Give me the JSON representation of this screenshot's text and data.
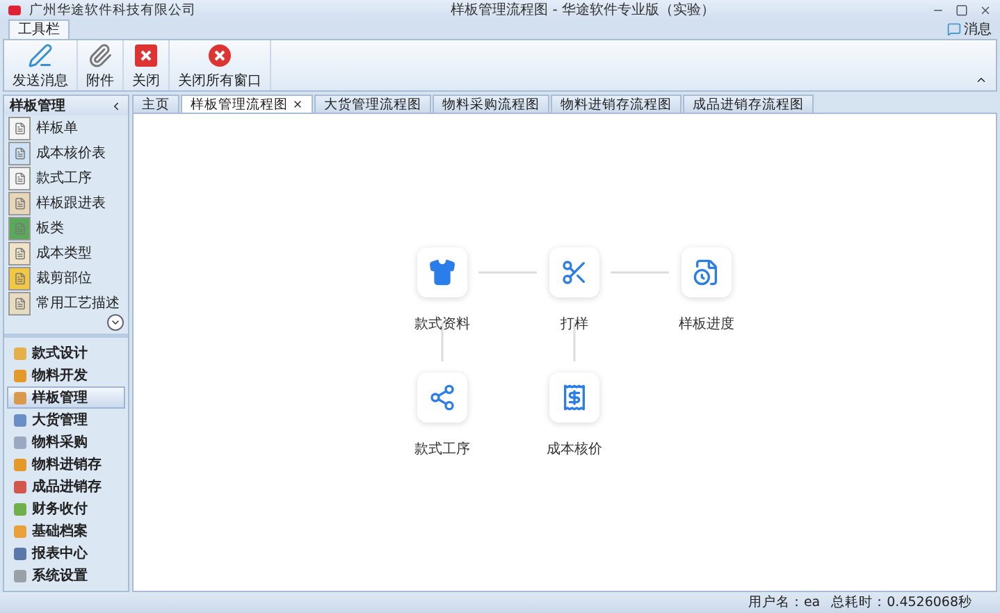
{
  "window": {
    "company": "广州华途软件科技有限公司",
    "title": "样板管理流程图 - 华途软件专业版（实验）"
  },
  "message_button": "消息",
  "ribbon": {
    "tab": "工具栏",
    "buttons": [
      {
        "kind": "send",
        "label": "发送消息"
      },
      {
        "kind": "attach",
        "label": "附件"
      },
      {
        "kind": "close",
        "label": "关闭"
      },
      {
        "kind": "closeall",
        "label": "关闭所有窗口"
      }
    ]
  },
  "doc_tabs": [
    {
      "label": "主页",
      "selected": false
    },
    {
      "label": "样板管理流程图",
      "selected": true
    },
    {
      "label": "大货管理流程图",
      "selected": false
    },
    {
      "label": "物料采购流程图",
      "selected": false
    },
    {
      "label": "物料进销存流程图",
      "selected": false
    },
    {
      "label": "成品进销存流程图",
      "selected": false
    }
  ],
  "sidebar": {
    "title": "样板管理",
    "items": [
      "样板单",
      "成本核价表",
      "款式工序",
      "样板跟进表",
      "板类",
      "成本类型",
      "裁剪部位",
      "常用工艺描述"
    ],
    "nav": [
      {
        "label": "款式设计",
        "selected": false
      },
      {
        "label": "物料开发",
        "selected": false
      },
      {
        "label": "样板管理",
        "selected": true
      },
      {
        "label": "大货管理",
        "selected": false
      },
      {
        "label": "物料采购",
        "selected": false
      },
      {
        "label": "物料进销存",
        "selected": false
      },
      {
        "label": "成品进销存",
        "selected": false
      },
      {
        "label": "财务收付",
        "selected": false
      },
      {
        "label": "基础档案",
        "selected": false
      },
      {
        "label": "报表中心",
        "selected": false
      },
      {
        "label": "系统设置",
        "selected": false
      }
    ]
  },
  "flow": [
    {
      "kind": "shirt",
      "label": "款式资料"
    },
    {
      "kind": "scissors",
      "label": "打样"
    },
    {
      "kind": "progress",
      "label": "样板进度"
    },
    {
      "kind": "network",
      "label": "款式工序"
    },
    {
      "kind": "price",
      "label": "成本核价"
    }
  ],
  "status_bar": {
    "user": "用户名：ea",
    "elapsed": "总耗时：0.4526068秒"
  }
}
